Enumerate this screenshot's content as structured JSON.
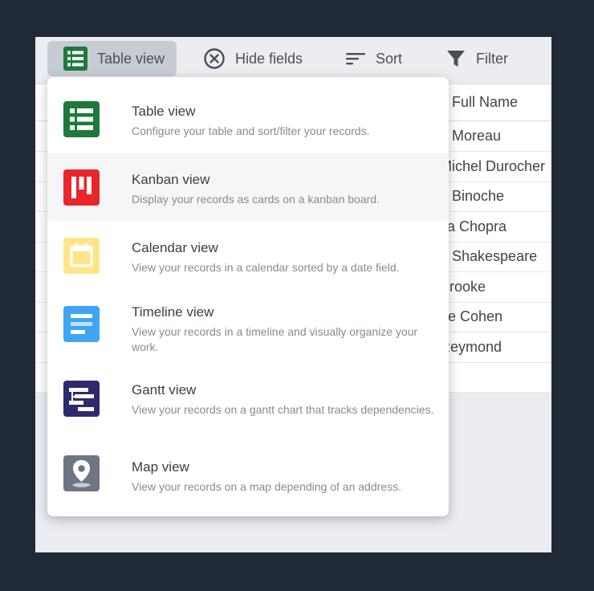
{
  "toolbar": {
    "view_label": "Table view",
    "hide_fields_label": "Hide fields",
    "sort_label": "Sort",
    "filter_label": "Filter"
  },
  "grid": {
    "column_header": "Full Name",
    "rows": [
      "e Moreau",
      "Michel Durocher",
      "e Binoche",
      "ka Chopra",
      "n Shakespeare",
      "Brooke",
      "ne Cohen",
      "Reymond",
      ""
    ]
  },
  "menu": {
    "items": [
      {
        "title": "Table view",
        "desc": "Configure your table and sort/filter your records.",
        "icon": "table-icon",
        "color": "#1e7a3c"
      },
      {
        "title": "Kanban view",
        "desc": "Display your records as cards on a kanban board.",
        "icon": "kanban-icon",
        "color": "#e8262b"
      },
      {
        "title": "Calendar view",
        "desc": "View your records in a calendar sorted by a date field.",
        "icon": "calendar-icon",
        "color": "#fde68a"
      },
      {
        "title": "Timeline view",
        "desc": "View your records in a timeline and visually organize your work.",
        "icon": "timeline-icon",
        "color": "#3fa5f0"
      },
      {
        "title": "Gantt view",
        "desc": "View your records on a gantt chart that tracks dependencies.",
        "icon": "gantt-icon",
        "color": "#2e2a6b"
      },
      {
        "title": "Map view",
        "desc": "View your records on a map depending of an address.",
        "icon": "map-pin-icon",
        "color": "#6e7686"
      }
    ]
  }
}
